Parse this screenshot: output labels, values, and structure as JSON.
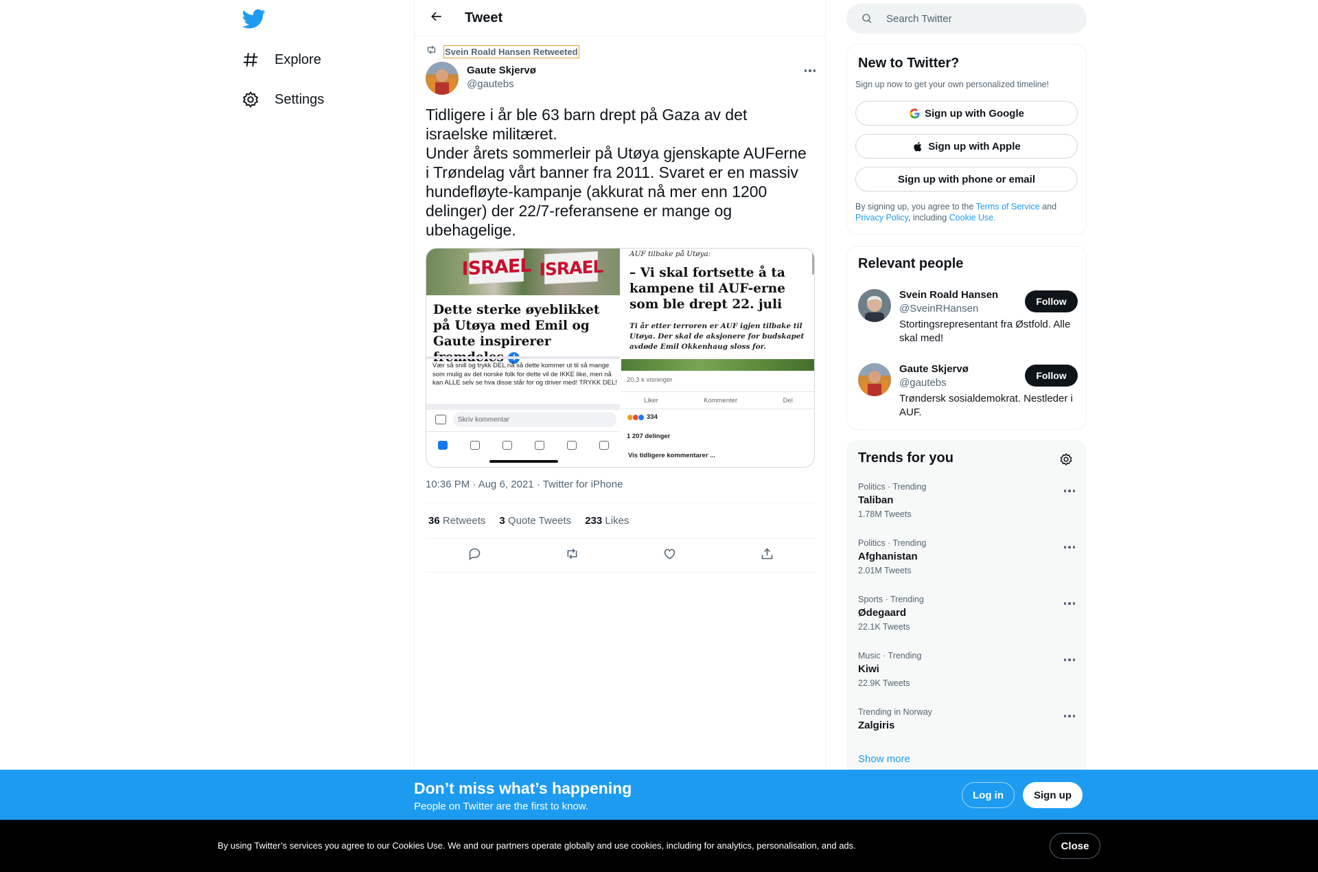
{
  "nav": {
    "logo": "twitter-bird-icon",
    "items": [
      {
        "label": "Explore",
        "icon": "hashtag-icon"
      },
      {
        "label": "Settings",
        "icon": "gear-icon"
      }
    ]
  },
  "header": {
    "title": "Tweet",
    "back_icon": "arrow-left-icon"
  },
  "tweet": {
    "retweeted_by": "Svein Roald Hansen Retweeted",
    "author_name": "Gaute Skjervø",
    "author_handle": "@gautebs",
    "text": "Tidligere i år ble 63 barn drept på Gaza av det israelske militæret.\nUnder årets sommerleir på Utøya gjenskapte AUFerne i Trøndelag vårt banner fra 2011. Svaret er en massiv hundefløyte-kampanje (akkurat nå mer enn 1200 delinger) der 22/7-referansene er mange og ubehagelige.",
    "timestamp": "10:36 PM · Aug 6, 2021",
    "source": "Twitter for iPhone",
    "stats": {
      "retweets_count": "36",
      "retweets_label": "Retweets",
      "quotes_count": "3",
      "quotes_label": "Quote Tweets",
      "likes_count": "233",
      "likes_label": "Likes"
    }
  },
  "media": {
    "left": {
      "banner_1": "ISRAEL",
      "banner_2": "ISRAEL",
      "headline": "Dette sterke øyeblikket på Utøya med Emil og Gaute inspirerer fremdeles",
      "body": "Vær så snill og trykk DEL nå så dette kommer ut til så mange som mulig av det norske folk for dette vil de IKKE like, men nå kan ALLE selv se hva disse står for og driver med! TRYKK DEL!",
      "comment_placeholder": "Skriv kommentar"
    },
    "right": {
      "kicker": "AUF tilbake på Utøya:",
      "headline": "– Vi skal fortsette å ta kampene til AUF-erne som ble drept 22. juli",
      "subline": "Ti år etter terroren er AUF igjen tilbake til Utøya. Der skal de aksjonere for budskapet avdøde Emil Okkenhaug sloss for.",
      "views": "20,3 k visninger",
      "like": "Liker",
      "comment": "Kommenter",
      "share": "Del",
      "reactions": "334",
      "shares": "1 207 delinger",
      "prev_comments": "Vis tidligere kommentarer ..."
    }
  },
  "search": {
    "placeholder": "Search Twitter"
  },
  "new_to_twitter": {
    "title": "New to Twitter?",
    "subtitle": "Sign up now to get your own personalized timeline!",
    "google": "Sign up with Google",
    "apple": "Sign up with Apple",
    "phone": "Sign up with phone or email",
    "legal_1": "By signing up, you agree to the ",
    "terms": "Terms of Service",
    "legal_2": " and ",
    "privacy": "Privacy Policy",
    "legal_3": ", including ",
    "cookie": "Cookie Use."
  },
  "relevant": {
    "title": "Relevant people",
    "people": [
      {
        "name": "Svein Roald Hansen",
        "handle": "@SveinRHansen",
        "bio": "Stortingsrepresentant fra Østfold. Alle skal med!",
        "follow": "Follow"
      },
      {
        "name": "Gaute Skjervø",
        "handle": "@gautebs",
        "bio": "Trøndersk sosialdemokrat. Nestleder i AUF.",
        "follow": "Follow"
      }
    ]
  },
  "trends": {
    "title": "Trends for you",
    "items": [
      {
        "context": "Politics · Trending",
        "name": "Taliban",
        "count": "1.78M Tweets"
      },
      {
        "context": "Politics · Trending",
        "name": "Afghanistan",
        "count": "2.01M Tweets"
      },
      {
        "context": "Sports · Trending",
        "name": "Ødegaard",
        "count": "22.1K Tweets"
      },
      {
        "context": "Music · Trending",
        "name": "Kiwi",
        "count": "22.9K Tweets"
      },
      {
        "context": "Trending in Norway",
        "name": "Zalgiris",
        "count": ""
      }
    ],
    "show_more": "Show more"
  },
  "bottom_bar": {
    "headline": "Don’t miss what’s happening",
    "sub": "People on Twitter are the first to know.",
    "login": "Log in",
    "signup": "Sign up"
  },
  "cookie_bar": {
    "text": "By using Twitter’s services you agree to our Cookies Use. We and our partners operate globally and use cookies, including for analytics, personalisation, and ads.",
    "close": "Close"
  },
  "colors": {
    "brand": "#1d9bf0",
    "text": "#0f1419",
    "muted": "#536471"
  }
}
